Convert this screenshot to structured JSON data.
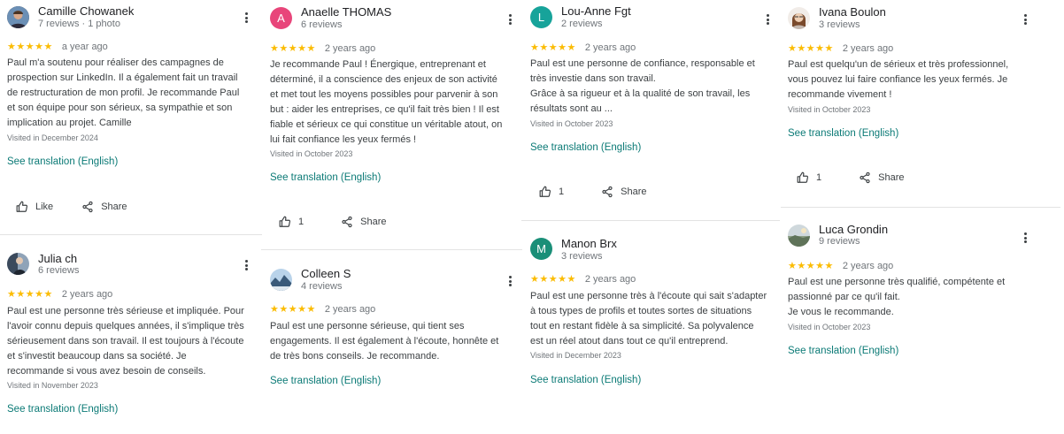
{
  "labels": {
    "see_translation": "See translation (English)",
    "like": "Like",
    "share": "Share",
    "stars": "★★★★★"
  },
  "colors": {
    "star": "#fbbc04",
    "translate_link": "#0b7a76",
    "avatar_anaelle": "#e8457a",
    "avatar_louanne": "#17a39a",
    "avatar_manon": "#1a8f78"
  },
  "reviews": [
    {
      "name": "Camille Chowanek",
      "meta": "7 reviews · 1 photo",
      "avatar": "photo",
      "rating": 5,
      "time": "a year ago",
      "text": "Paul m'a soutenu pour réaliser des campagnes de\nprospection sur LinkedIn. Il a également fait un travail\nde restructuration de mon profil. Je recommande Paul\net son équipe pour son sérieux, sa sympathie et son\nimplication au projet. Camille",
      "visited": "Visited in December 2024",
      "like_label": "Like"
    },
    {
      "name": "Julia ch",
      "meta": "6 reviews",
      "avatar": "photo",
      "rating": 5,
      "time": "2 years ago",
      "text": "Paul est une personne très sérieuse et impliquée. Pour\nl'avoir connu depuis quelques années, il s'implique très\nsérieusement dans son travail. Il est toujours à l'écoute\net s'investit beaucoup dans sa société. Je\nrecommande si vous avez besoin de conseils.",
      "visited": "Visited in November 2023"
    },
    {
      "name": "Anaelle THOMAS",
      "meta": "6 reviews",
      "avatar_letter": "A",
      "rating": 5,
      "time": "2 years ago",
      "text": "Je recommande Paul ! Énergique, entreprenant et\ndéterminé, il a conscience des enjeux de son activité\net met tout les moyens possibles pour parvenir à son\nbut : aider les entreprises, ce qu'il fait très bien ! Il est\nfiable et sérieux ce qui constitue un véritable atout, on\nlui fait confiance les yeux fermés !",
      "visited": "Visited in October 2023",
      "likes": "1"
    },
    {
      "name": "Colleen S",
      "meta": "4 reviews",
      "avatar": "photo",
      "rating": 5,
      "time": "2 years ago",
      "text": "Paul est une personne sérieuse, qui tient ses\nengagements. Il est également à l'écoute, honnête et\nde très bons conseils. Je recommande.",
      "visited": ""
    },
    {
      "name": "Lou-Anne Fgt",
      "meta": "2 reviews",
      "avatar_letter": "L",
      "rating": 5,
      "time": "2 years ago",
      "text": "Paul est une personne de confiance, responsable et\ntrès investie dans son travail.\nGrâce à sa rigueur et à la qualité de son travail, les\nrésultats sont au ...",
      "visited": "Visited in October 2023",
      "likes": "1"
    },
    {
      "name": "Manon Brx",
      "meta": "3 reviews",
      "avatar_letter": "M",
      "rating": 5,
      "time": "2 years ago",
      "text": "Paul est une personne très à l'écoute qui sait s'adapter\nà tous types de profils et toutes sortes de situations\ntout en restant fidèle à sa simplicité. Sa polyvalence\nest un réel atout dans tout ce qu'il entreprend.",
      "visited": "Visited in December 2023"
    },
    {
      "name": "Ivana Boulon",
      "meta": "3 reviews",
      "avatar": "photo",
      "rating": 5,
      "time": "2 years ago",
      "text": "Paul est quelqu'un de sérieux et très professionnel,\nvous pouvez lui faire confiance les yeux fermés. Je\nrecommande vivement !",
      "visited": "Visited in October 2023",
      "likes": "1"
    },
    {
      "name": "Luca Grondin",
      "meta": "9 reviews",
      "avatar": "photo",
      "rating": 5,
      "time": "2 years ago",
      "text": "Paul est une personne très qualifié, compétente et\npassionné par ce qu'il fait.\nJe vous le recommande.",
      "visited": "Visited in October 2023"
    }
  ]
}
